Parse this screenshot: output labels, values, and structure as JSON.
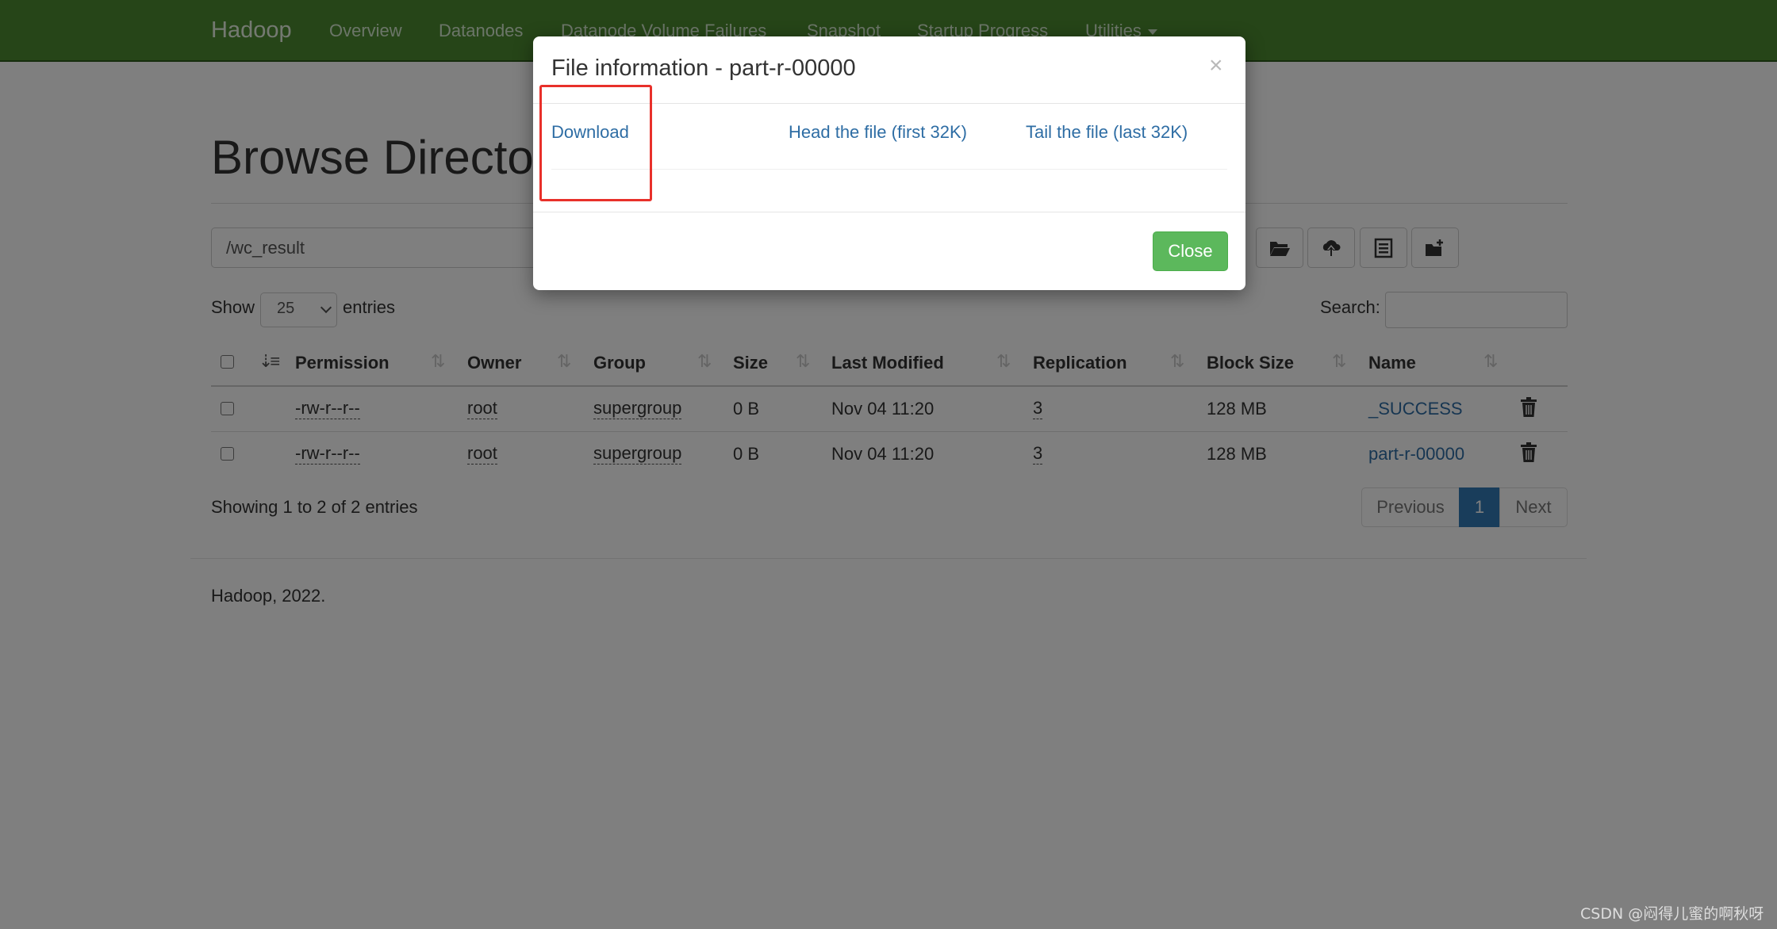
{
  "navbar": {
    "brand": "Hadoop",
    "items": [
      "Overview",
      "Datanodes",
      "Datanode Volume Failures",
      "Snapshot",
      "Startup Progress",
      "Utilities"
    ],
    "bg_color": "#4d8b31"
  },
  "page": {
    "title": "Browse Directory",
    "path_value": "/wc_result",
    "show_label": "Show",
    "entries_value": "25",
    "entries_label": "entries",
    "search_label": "Search:",
    "toolbar_icons": [
      "folder-open-icon",
      "cloud-upload-icon",
      "list-alt-icon",
      "folder-plus-icon"
    ]
  },
  "table": {
    "columns": [
      "Permission",
      "Owner",
      "Group",
      "Size",
      "Last Modified",
      "Replication",
      "Block Size",
      "Name"
    ],
    "rows": [
      {
        "permission": "-rw-r--r--",
        "owner": "root",
        "group": "supergroup",
        "size": "0 B",
        "modified": "Nov 04 11:20",
        "replication": "3",
        "block_size": "128 MB",
        "name": "_SUCCESS"
      },
      {
        "permission": "-rw-r--r--",
        "owner": "root",
        "group": "supergroup",
        "size": "0 B",
        "modified": "Nov 04 11:20",
        "replication": "3",
        "block_size": "128 MB",
        "name": "part-r-00000"
      }
    ],
    "summary": "Showing 1 to 2 of 2 entries"
  },
  "pagination": {
    "previous": "Previous",
    "current": "1",
    "next": "Next"
  },
  "footer": "Hadoop, 2022.",
  "modal": {
    "title": "File information - part-r-00000",
    "close_x": "×",
    "download": "Download",
    "head": "Head the file (first 32K)",
    "tail": "Tail the file (last 32K)",
    "close_button": "Close",
    "highlight_color": "#e8302a"
  },
  "watermark": "CSDN @闷得儿蜜的啊秋呀"
}
